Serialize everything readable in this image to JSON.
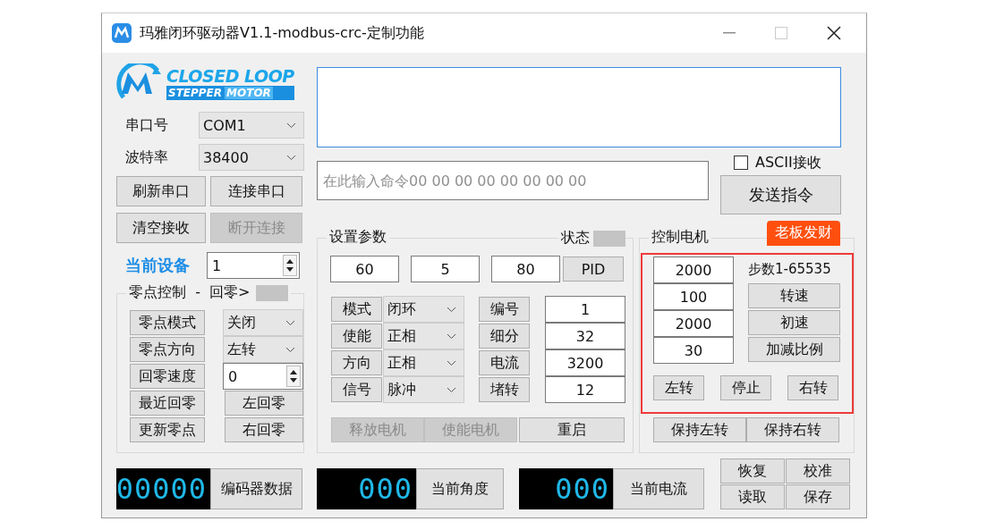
{
  "window": {
    "title": "玛雅闭环驱动器V1.1-modbus-crc-定制功能"
  },
  "logo": {
    "line1": "CLOSED LOOP",
    "band_left": "STEPPER",
    "band_right": "MOTOR"
  },
  "serial": {
    "port_label": "串口号",
    "port": "COM1",
    "baud_label": "波特率",
    "baud": "38400"
  },
  "serial_buttons": [
    {
      "label": "刷新串口",
      "disabled": false
    },
    {
      "label": "连接串口",
      "disabled": false
    },
    {
      "label": "清空接收",
      "disabled": false
    },
    {
      "label": "断开连接",
      "disabled": true
    }
  ],
  "device": {
    "label": "当前设备",
    "value": "1"
  },
  "zero": {
    "title": "零点控制  -  回零>",
    "rows": [
      {
        "kind": "combo",
        "button": "零点模式",
        "value": "关闭"
      },
      {
        "kind": "combo",
        "button": "零点方向",
        "value": "左转"
      },
      {
        "kind": "spin",
        "button": "回零速度",
        "value": "0"
      },
      {
        "kind": "button",
        "button": "最近回零",
        "value": "左回零"
      },
      {
        "kind": "button",
        "button": "更新零点",
        "value": "右回零"
      }
    ]
  },
  "command": {
    "placeholder": "在此输入命令00 00 00 00 00 00 00 00"
  },
  "ascii": {
    "label": "ASCII接收",
    "checked": false
  },
  "send_button": "发送指令",
  "params": {
    "title": "设置参数",
    "status_label": "状态",
    "pid_values": [
      "60",
      "5",
      "80"
    ],
    "pid_button": "PID",
    "rows": [
      {
        "label": "模式",
        "value": "闭环",
        "field": "编号",
        "field_value": "1"
      },
      {
        "label": "使能",
        "value": "正相",
        "field": "细分",
        "field_value": "32"
      },
      {
        "label": "方向",
        "value": "正相",
        "field": "电流",
        "field_value": "3200"
      },
      {
        "label": "信号",
        "value": "脉冲",
        "field": "堵转",
        "field_value": "12"
      }
    ],
    "buttons": [
      {
        "label": "释放电机",
        "disabled": true
      },
      {
        "label": "使能电机",
        "disabled": true
      },
      {
        "label": "重启",
        "disabled": false
      }
    ]
  },
  "control": {
    "title": "控制电机",
    "tag": "老板发财",
    "steps_label": "步数1-65535",
    "values": [
      "2000",
      "100",
      "2000",
      "30"
    ],
    "value_buttons": [
      "转速",
      "初速",
      "加减比例"
    ],
    "dir_buttons": [
      "左转",
      "停止",
      "右转"
    ],
    "hold_buttons": [
      "保持左转",
      "保持右转"
    ]
  },
  "displays": [
    {
      "digits": "00000",
      "label": "编码器数据"
    },
    {
      "digits": "000",
      "label": "当前角度"
    },
    {
      "digits": "000",
      "label": "当前电流"
    }
  ],
  "misc_buttons": [
    "恢复",
    "校准",
    "读取",
    "保存"
  ]
}
